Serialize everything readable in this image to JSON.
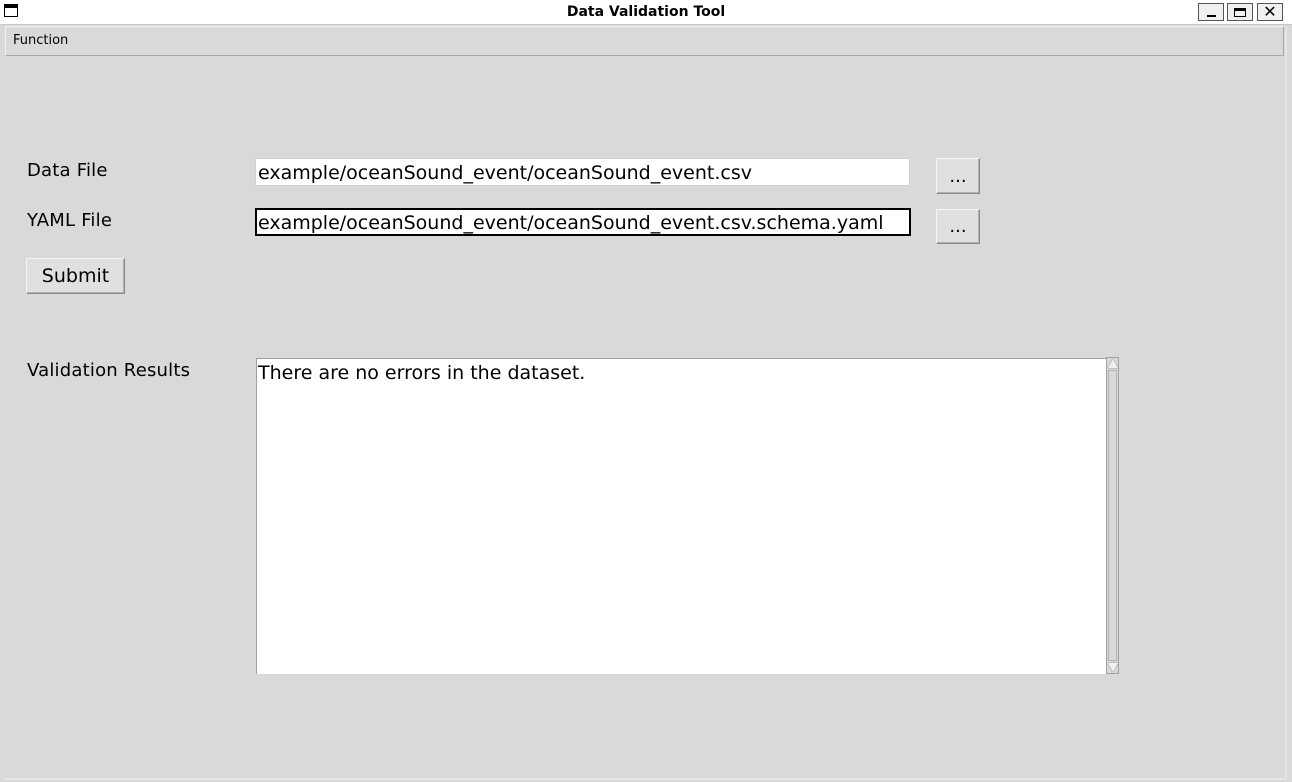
{
  "window": {
    "title": "Data Validation Tool"
  },
  "menubar": {
    "items": [
      {
        "label": "Function"
      }
    ]
  },
  "form": {
    "data_file_label": "Data File",
    "data_file_value": "example/oceanSound_event/oceanSound_event.csv",
    "yaml_file_label": "YAML File",
    "yaml_file_value": "example/oceanSound_event/oceanSound_event.csv.schema.yaml",
    "browse_label": "...",
    "submit_label": "Submit"
  },
  "results": {
    "label": "Validation Results",
    "text": "There are no errors in the dataset."
  }
}
